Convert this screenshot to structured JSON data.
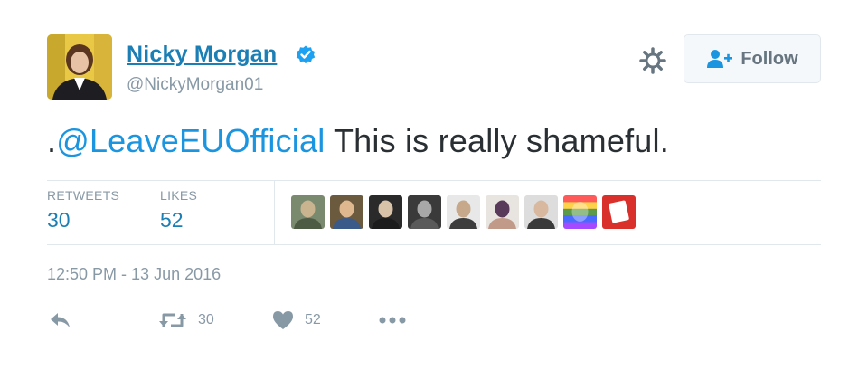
{
  "user": {
    "name": "Nicky Morgan",
    "handle": "@NickyMorgan01",
    "verified": true,
    "avatar_icon": "profile-photo"
  },
  "header": {
    "follow_label": "Follow",
    "settings_icon": "gear-icon"
  },
  "tweet": {
    "prefix": ".",
    "mention": "@LeaveEUOfficial",
    "text": " This is really shameful."
  },
  "stats": {
    "retweets_label": "RETWEETS",
    "retweets_count": "30",
    "likes_label": "LIKES",
    "likes_count": "52"
  },
  "likers": [
    {
      "colors": [
        "#7a8a6e",
        "#c9b48f",
        "#4d5a44"
      ]
    },
    {
      "colors": [
        "#6b5a3e",
        "#e0b890",
        "#3a5a8a"
      ]
    },
    {
      "colors": [
        "#2a2a2a",
        "#d9c3a8",
        "#1c1c1c"
      ]
    },
    {
      "colors": [
        "#3a3a3a",
        "#a8a8a8",
        "#5a5a5a"
      ]
    },
    {
      "colors": [
        "#e8e8e8",
        "#c7a88a",
        "#3d3d3d"
      ]
    },
    {
      "colors": [
        "#e8e4e0",
        "#5a3a5a",
        "#c29a8a"
      ]
    },
    {
      "colors": [
        "#ddd",
        "#d8b9a0",
        "#3a3a3a"
      ]
    },
    {
      "colors": [
        "#ff5a5a",
        "#ffd24a",
        "#5a9a4a",
        "#4a6aff",
        "#a64aff"
      ]
    },
    {
      "colors": [
        "#d9302c",
        "#ffffff"
      ]
    }
  ],
  "timestamp": "12:50 PM - 13 Jun 2016",
  "actions": {
    "retweet_count": "30",
    "like_count": "52"
  },
  "colors": {
    "link": "#1b95e0",
    "name": "#1b7fb5",
    "muted": "#8899a6",
    "verified": "#1da1f2"
  }
}
